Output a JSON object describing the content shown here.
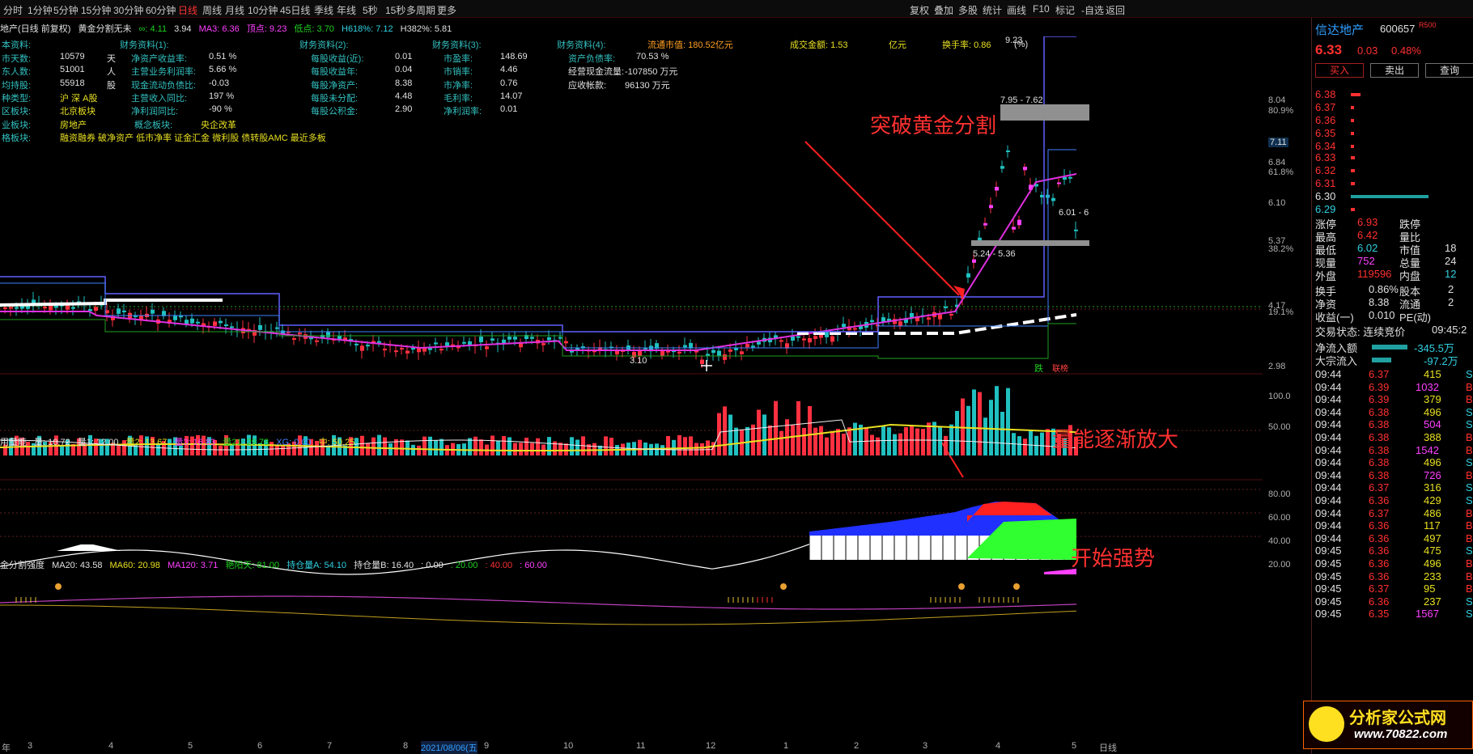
{
  "toolbar": {
    "periods": [
      "分时",
      "1分钟",
      "5分钟",
      "15分钟",
      "30分钟",
      "60分钟",
      "日线",
      "周线",
      "月线",
      "10分钟",
      "45日线",
      "季线",
      "年线",
      "5秒",
      "15秒",
      "多周期",
      "更多"
    ],
    "active": "日线",
    "right": [
      "复权",
      "叠加",
      "多股",
      "统计",
      "画线",
      "F10",
      "标记",
      "-自选",
      "返回"
    ]
  },
  "subtitle": {
    "name": "地产(日线 前复权)",
    "indicator": "黄金分割无未",
    "v1": "∞: 4.11",
    "v2": "3.94",
    "ma3": "MA3: 6.36",
    "top": "顶点: 9.23",
    "low": "低点: 3.70",
    "h618": "H618%: 7.12",
    "h382": "H382%: 5.81"
  },
  "fin": [
    {
      "l": "本资料:",
      "v": "",
      "u": ""
    },
    {
      "l": "市天数:",
      "v": "10579",
      "u": "天"
    },
    {
      "l": "东人数:",
      "v": "51001",
      "u": "人"
    },
    {
      "l": "均持股:",
      "v": "55918",
      "u": "股"
    },
    {
      "l": "种类型:",
      "v": "沪 深 A股",
      "u": ""
    },
    {
      "l": "区板块:",
      "v": "北京板块",
      "u": ""
    },
    {
      "l": "业板块:",
      "v": "房地产",
      "u": ""
    },
    {
      "l": "格板块:",
      "v": "融资融券 破净资产 低市净率 证金汇金 微利股 债转股AMC 最近多板",
      "u": ""
    }
  ],
  "fin1": {
    "title": "财务资料(1):",
    "rows": [
      [
        "净资产收益率:",
        "0.51 %"
      ],
      [
        "主营业务利润率:",
        "5.66 %"
      ],
      [
        "现金流动负债比:",
        "-0.03"
      ],
      [
        "主营收入同比:",
        "197 %"
      ],
      [
        "净利润同比:",
        "-90 %"
      ]
    ],
    "concept": "概念板块:",
    "concept_v": "央企改革"
  },
  "fin2": {
    "title": "财务资料(2):",
    "rows": [
      [
        "每股收益(近):",
        "0.01"
      ],
      [
        "每股收益年:",
        "0.04"
      ],
      [
        "每股净资产:",
        "8.38"
      ],
      [
        "每股未分配:",
        "4.48"
      ],
      [
        "每股公积金:",
        "2.90"
      ]
    ]
  },
  "fin3": {
    "title": "财务资料(3):",
    "rows": [
      [
        "市盈率:",
        "148.69"
      ],
      [
        "市销率:",
        "4.46"
      ],
      [
        "市净率:",
        "0.76"
      ],
      [
        "毛利率:",
        "14.07"
      ],
      [
        "净利润率:",
        "0.01"
      ]
    ]
  },
  "fin4": {
    "title": "财务资料(4):",
    "rows": [
      [
        "资产负债率:",
        "70.53 %"
      ],
      [
        "经营现金流量:",
        "-107850 万元"
      ],
      [
        "应收帐款:",
        "96130 万元"
      ]
    ]
  },
  "fin_top": {
    "mv": "流通市值: 180.52亿元",
    "amt": "成交金额: 1.53",
    "yi": "亿元",
    "turn": "换手率: 0.86",
    "pct": "(%)"
  },
  "annotations": {
    "a1": "突破黄金分割",
    "a2": "量能逐渐放大",
    "a3": "开始强势"
  },
  "price_labels": {
    "band1": "7.95 - 7.62",
    "band2": "5.24 - 5.36",
    "band3": "6.01 - 6",
    "top": "9.23",
    "bottom": "3.10",
    "die": "跌",
    "lmk": "联榜"
  },
  "price_axis": [
    {
      "v": "8.04"
    },
    {
      "v": "80.9%"
    },
    {
      "v": "6.84"
    },
    {
      "v": "61.8%"
    },
    {
      "v": "7.11"
    },
    {
      "v": "6.10"
    },
    {
      "v": "5.37"
    },
    {
      "v": "38.2%"
    },
    {
      "v": "4.17"
    },
    {
      "v": "19.1%"
    },
    {
      "v": "2.98"
    }
  ],
  "vol_legend": {
    "name": "用量能",
    "a": "量: 10.72",
    "b": "量1: 12.00",
    "c": "量2: 13.67",
    "d": "量3: 16.83",
    "e": "量21: 29.78",
    "f": "XG: 0.00",
    "g": "中: 50.25"
  },
  "vol_axis": [
    "100.0",
    "50.00"
  ],
  "ind_legend": {
    "name": "金分割强度",
    "a": "MA20: 43.58",
    "b": "MA60: 20.98",
    "c": "MA120: 3.71",
    "d": "艳阳天: 81.00",
    "e": "持仓量A: 54.10",
    "f": "持仓量B: 16.40",
    "g": ": 0.00",
    "h": ": 20.00",
    "i": ": 40.00",
    "j": ": 60.00"
  },
  "ind_axis": [
    "80.00",
    "60.00",
    "40.00",
    "20.00"
  ],
  "x_axis": [
    "年",
    "3",
    "4",
    "5",
    "6",
    "7",
    "8",
    "9",
    "10",
    "11",
    "12",
    "1",
    "2",
    "3",
    "4",
    "5"
  ],
  "x_date": "2021/08/06(五",
  "x_day": "日线",
  "right_panel": {
    "name": "信达地产",
    "code": "600657",
    "badge": "R500",
    "price": "6.33",
    "chg": "0.03",
    "pct": "0.48%",
    "buy": "买入",
    "sell": "卖出",
    "query": "查询",
    "asks": [
      [
        "6.38"
      ],
      [
        "6.37"
      ],
      [
        "6.36"
      ],
      [
        "6.35"
      ],
      [
        "6.34"
      ]
    ],
    "bids": [
      [
        "6.33"
      ],
      [
        "6.32"
      ],
      [
        "6.31"
      ],
      [
        "6.30"
      ],
      [
        "6.29"
      ]
    ],
    "stats": [
      [
        "涨停",
        "6.93",
        "跌停",
        ""
      ],
      [
        "最高",
        "6.42",
        "量比",
        ""
      ],
      [
        "最低",
        "6.02",
        "市值",
        "18"
      ],
      [
        "现量",
        "752",
        "总量",
        "24"
      ],
      [
        "外盘",
        "119596",
        "内盘",
        "12"
      ]
    ],
    "stats2": [
      [
        "换手",
        "0.86%",
        "股本",
        "2"
      ],
      [
        "净资",
        "8.38",
        "流通",
        "2"
      ],
      [
        "收益(一)",
        "0.010",
        "PE(动)",
        ""
      ]
    ],
    "trade_state": "交易状态: 连续竞价",
    "time": "09:45:2",
    "flow1": "净流入额",
    "flow1_v": "-345.5万",
    "flow2": "大宗流入",
    "flow2_v": "-97.2万",
    "ticks": [
      [
        "09:44",
        "6.37",
        "415",
        "S"
      ],
      [
        "09:44",
        "6.39",
        "1032",
        "B"
      ],
      [
        "09:44",
        "6.39",
        "379",
        "B"
      ],
      [
        "09:44",
        "6.38",
        "496",
        "S"
      ],
      [
        "09:44",
        "6.38",
        "504",
        "S"
      ],
      [
        "09:44",
        "6.38",
        "388",
        "B"
      ],
      [
        "09:44",
        "6.38",
        "1542",
        "B"
      ],
      [
        "09:44",
        "6.38",
        "496",
        "S"
      ],
      [
        "09:44",
        "6.38",
        "726",
        "B"
      ],
      [
        "09:44",
        "6.37",
        "316",
        "S"
      ],
      [
        "09:44",
        "6.36",
        "429",
        "S"
      ],
      [
        "09:44",
        "6.37",
        "486",
        "B"
      ],
      [
        "09:44",
        "6.36",
        "117",
        "B"
      ],
      [
        "09:44",
        "6.36",
        "497",
        "B"
      ],
      [
        "09:45",
        "6.36",
        "475",
        "S"
      ],
      [
        "09:45",
        "6.36",
        "496",
        "B"
      ],
      [
        "09:45",
        "6.36",
        "233",
        "B"
      ],
      [
        "09:45",
        "6.37",
        "95",
        "B"
      ],
      [
        "09:45",
        "6.36",
        "237",
        "S"
      ],
      [
        "09:45",
        "6.35",
        "1567",
        "S"
      ]
    ]
  },
  "logo": {
    "text": "分析家公式网",
    "url": "www.70822.com"
  }
}
